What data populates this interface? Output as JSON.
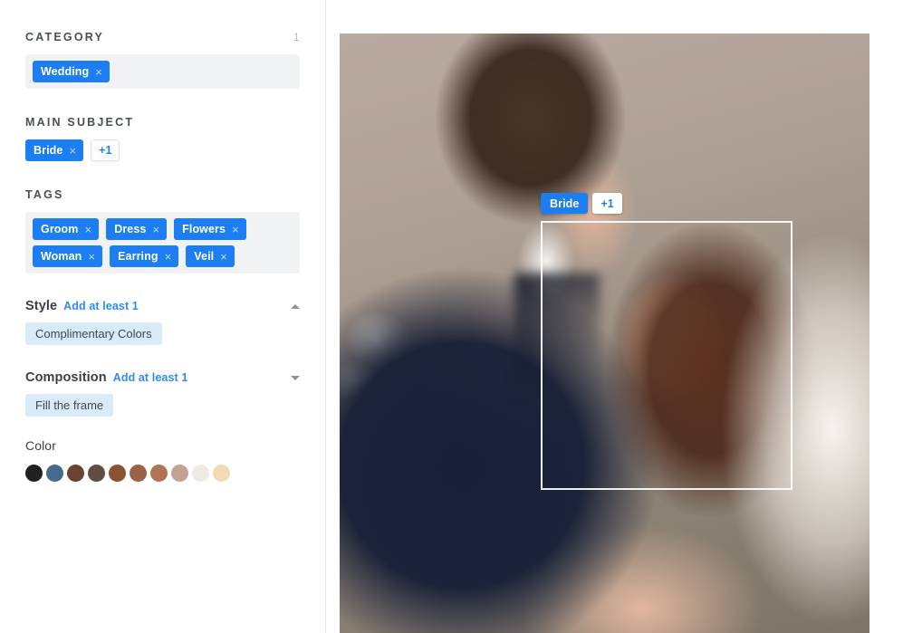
{
  "sidebar": {
    "category": {
      "title": "CATEGORY",
      "count": "1",
      "chips": [
        {
          "label": "Wedding",
          "remove": "×"
        }
      ]
    },
    "main_subject": {
      "title": "MAIN SUBJECT",
      "chips": [
        {
          "label": "Bride",
          "remove": "×"
        }
      ],
      "more_label": "+1"
    },
    "tags": {
      "title": "TAGS",
      "chips": [
        {
          "label": "Groom",
          "remove": "×"
        },
        {
          "label": "Dress",
          "remove": "×"
        },
        {
          "label": "Flowers",
          "remove": "×"
        },
        {
          "label": "Woman",
          "remove": "×"
        },
        {
          "label": "Earring",
          "remove": "×"
        },
        {
          "label": "Veil",
          "remove": "×"
        }
      ]
    },
    "style": {
      "title": "Style",
      "hint": "Add at least 1",
      "caret": "caret-up-icon",
      "chips": [
        {
          "label": "Complimentary Colors"
        }
      ]
    },
    "composition": {
      "title": "Composition",
      "hint": "Add at least 1",
      "caret": "caret-down-icon",
      "chips": [
        {
          "label": "Fill the frame"
        }
      ]
    },
    "color": {
      "title": "Color",
      "swatches": [
        "#231f20",
        "#466a8c",
        "#6b4334",
        "#5f4e44",
        "#8a5230",
        "#9c6243",
        "#b07550",
        "#c4a291",
        "#eeeae3",
        "#f4d9b5"
      ]
    }
  },
  "viewer": {
    "overlay_badge": {
      "label": "Bride",
      "more_label": "+1"
    },
    "face_box": "face-detection-rectangle",
    "accent_color": "#1c7ef2"
  }
}
